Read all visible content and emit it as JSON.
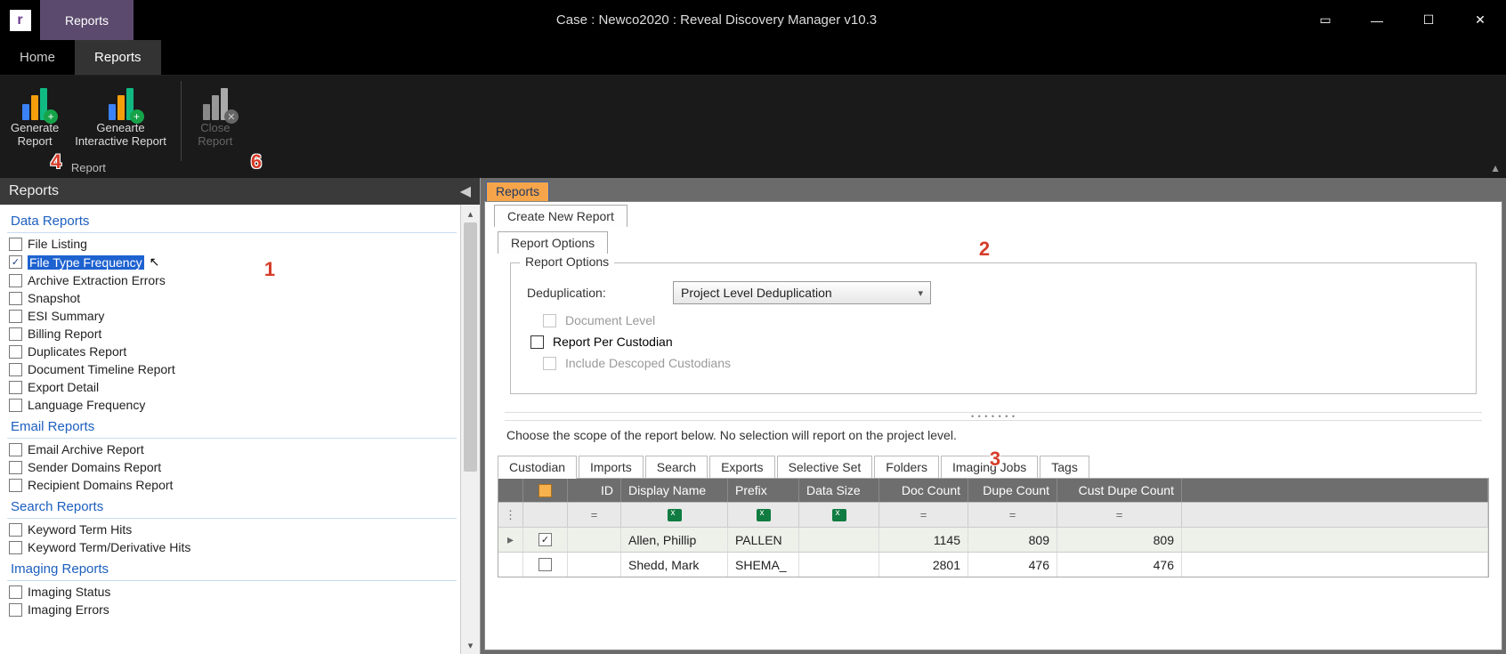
{
  "window": {
    "title": "Case : Newco2020 : Reveal Discovery Manager  v10.3",
    "top_tab": "Reports"
  },
  "menu": {
    "home": "Home",
    "reports": "Reports"
  },
  "ribbon": {
    "generate": "Generate\nReport",
    "interactive": "Genearte\nInteractive Report",
    "close": "Close\nReport",
    "group_label": "Report"
  },
  "callouts": {
    "c1": "1",
    "c2": "2",
    "c3": "3",
    "c4": "4",
    "c6": "6"
  },
  "left": {
    "header": "Reports",
    "sections": {
      "data": {
        "title": "Data Reports",
        "items": [
          {
            "label": "File Listing",
            "checked": false
          },
          {
            "label": "File Type Frequency",
            "checked": true,
            "selected": true
          },
          {
            "label": "Archive Extraction Errors",
            "checked": false
          },
          {
            "label": "Snapshot",
            "checked": false
          },
          {
            "label": "ESI Summary",
            "checked": false
          },
          {
            "label": "Billing Report",
            "checked": false
          },
          {
            "label": "Duplicates Report",
            "checked": false
          },
          {
            "label": "Document Timeline Report",
            "checked": false
          },
          {
            "label": "Export Detail",
            "checked": false
          },
          {
            "label": "Language Frequency",
            "checked": false
          }
        ]
      },
      "email": {
        "title": "Email Reports",
        "items": [
          {
            "label": "Email Archive Report",
            "checked": false
          },
          {
            "label": "Sender Domains Report",
            "checked": false
          },
          {
            "label": "Recipient Domains Report",
            "checked": false
          }
        ]
      },
      "search": {
        "title": "Search Reports",
        "items": [
          {
            "label": "Keyword Term Hits",
            "checked": false
          },
          {
            "label": "Keyword Term/Derivative Hits",
            "checked": false
          }
        ]
      },
      "imaging": {
        "title": "Imaging Reports",
        "items": [
          {
            "label": "Imaging Status",
            "checked": false
          },
          {
            "label": "Imaging Errors",
            "checked": false
          }
        ]
      }
    }
  },
  "right": {
    "tab": "Reports",
    "subtab1": "Create New Report",
    "subtab2": "Report Options",
    "fieldset_legend": "Report Options",
    "dedup_label": "Deduplication:",
    "dedup_value": "Project Level Deduplication",
    "doc_level": "Document Level",
    "per_custodian": "Report Per Custodian",
    "include_descoped": "Include Descoped Custodians",
    "scope_text": "Choose the scope of the report below. No selection will report on the project level.",
    "grid_tabs": [
      "Custodian",
      "Imports",
      "Search",
      "Exports",
      "Selective Set",
      "Folders",
      "Imaging Jobs",
      "Tags"
    ],
    "columns": {
      "id": "ID",
      "name": "Display Name",
      "prefix": "Prefix",
      "size": "Data Size",
      "doc": "Doc Count",
      "dupe": "Dupe Count",
      "cdupe": "Cust Dupe Count"
    },
    "filter_eq": "=",
    "rows": [
      {
        "checked": true,
        "id": "",
        "name": "Allen, Phillip",
        "prefix": "PALLEN",
        "size": "",
        "doc": "1145",
        "dupe": "809",
        "cdupe": "809"
      },
      {
        "checked": false,
        "id": "",
        "name": "Shedd, Mark",
        "prefix": "SHEMA_",
        "size": "",
        "doc": "2801",
        "dupe": "476",
        "cdupe": "476"
      }
    ]
  }
}
